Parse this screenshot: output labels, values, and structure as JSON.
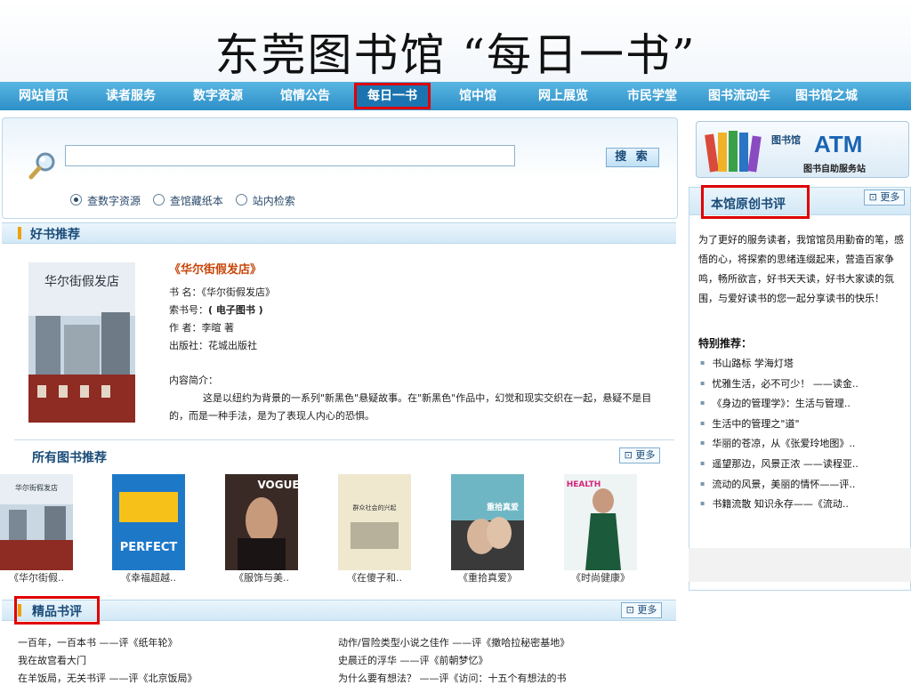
{
  "slide": {
    "title": "东莞图书馆 “每日一书”"
  },
  "nav": {
    "items": [
      "网站首页",
      "读者服务",
      "数字资源",
      "馆情公告",
      "每日一书",
      "馆中馆",
      "网上展览",
      "市民学堂",
      "图书流动车",
      "图书馆之城"
    ],
    "active": "每日一书"
  },
  "search": {
    "placeholder": "",
    "button_label": "搜 索",
    "options": [
      "查数字资源",
      "查馆藏纸本",
      "站内检索"
    ],
    "selected": "查数字资源"
  },
  "featured": {
    "section_title": "好书推荐",
    "cover_text": "华尔街假发店",
    "title": "《华尔街假发店》",
    "fields": [
      {
        "label": "书 名：",
        "value": "《华尔街假发店》"
      },
      {
        "label": "索书号：",
        "value": "( 电子图书 )"
      },
      {
        "label": "作 者：",
        "value": "李暄  著"
      },
      {
        "label": "出版社：",
        "value": "花城出版社"
      }
    ],
    "intro_label": "内容简介：",
    "intro_text": "这是以纽约为背景的一系列\"新黑色\"悬疑故事。在\"新黑色\"作品中，幻觉和现实交织在一起，悬疑不是目的，而是一种手法，是为了表现人内心的恐惧。"
  },
  "all_books": {
    "section_title": "所有图书推荐",
    "more_label": "更多",
    "items": [
      {
        "caption": "《华尔街假..",
        "cover_text": "华尔街假发店"
      },
      {
        "caption": "《幸福超越..",
        "cover_text": "PERFECT"
      },
      {
        "caption": "《服饰与美..",
        "cover_text": "VOGUE"
      },
      {
        "caption": "《在傻子和..",
        "cover_text": "群众社会的兴起"
      },
      {
        "caption": "《重拾真爱》",
        "cover_text": "重拾真爱"
      },
      {
        "caption": "《时尚健康》",
        "cover_text": "HEALTH"
      }
    ]
  },
  "reviews": {
    "section_title": "精品书评",
    "more_label": "更多",
    "left": [
      "一百年，一百本书 ——评《纸年轮》",
      "我在故宫看大门",
      "在羊饭局，无关书评 ——评《北京饭局》"
    ],
    "right": [
      "动作/冒险类型小说之佳作 ——评《撒哈拉秘密基地》",
      "史晨迁的浮华 ——评《前朝梦忆》",
      "为什么要有想法？ ——评《访问：十五个有想法的书"
    ]
  },
  "sidebar": {
    "atm": {
      "lib": "图书馆",
      "big": "ATM",
      "sub": "图书自助服务站"
    },
    "panel_title": "本馆原创书评",
    "more_label": "更多",
    "intro": "为了更好的服务读者，我馆馆员用勤奋的笔，感悟的心，将探索的思绪连缀起来，营造百家争鸣，畅所欲言，好书天天读，好书大家读的氛围，与爱好读书的您一起分享读书的快乐！",
    "special_label": "特别推荐：",
    "list": [
      "书山路标 学海灯塔",
      "忧雅生活，必不可少！ ——读金..",
      "《身边的管理学》：生活与管理..",
      "生活中的管理之\"道\"",
      "华丽的苍凉，从《张爱玲地图》..",
      "遥望那边，风景正浓 ——读程亚..",
      "流动的风景，美丽的情怀——评..",
      "书籍流散  知识永存——《流动.."
    ]
  },
  "colors": {
    "accent": "#2c8fc8",
    "highlight": "#e00000",
    "title_orange": "#c8460a"
  }
}
